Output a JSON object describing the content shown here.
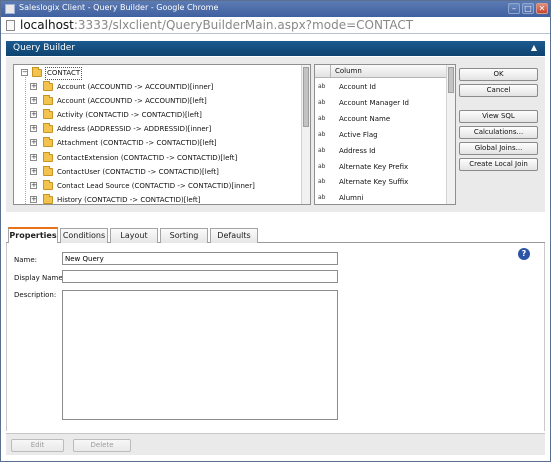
{
  "window": {
    "title": "Saleslogix Client - Query Builder - Google Chrome",
    "minimize_glyph": "–",
    "maximize_glyph": "□",
    "close_glyph": "✕"
  },
  "address_bar": {
    "host": "localhost",
    "rest": ":3333/slxclient/QueryBuilderMain.aspx?mode=CONTACT"
  },
  "header": {
    "title": "Query Builder",
    "pin_icon": "pin-icon"
  },
  "tree": {
    "root": {
      "label": "CONTACT",
      "expander": "−"
    },
    "items": [
      {
        "label": "Account (ACCOUNTID -> ACCOUNTID)[inner]",
        "expander": "+"
      },
      {
        "label": "Account (ACCOUNTID -> ACCOUNTID)[left]",
        "expander": "+"
      },
      {
        "label": "Activity (CONTACTID -> CONTACTID)[left]",
        "expander": "+"
      },
      {
        "label": "Address (ADDRESSID -> ADDRESSID)[inner]",
        "expander": "+"
      },
      {
        "label": "Attachment (CONTACTID -> CONTACTID)[left]",
        "expander": "+"
      },
      {
        "label": "ContactExtension (CONTACTID -> CONTACTID)[left]",
        "expander": "+"
      },
      {
        "label": "ContactUser (CONTACTID -> CONTACTID)[left]",
        "expander": "+"
      },
      {
        "label": "Contact Lead Source (CONTACTID -> CONTACTID)[inner]",
        "expander": "+"
      },
      {
        "label": "History (CONTACTID -> CONTACTID)[left]",
        "expander": "+"
      }
    ]
  },
  "columns": {
    "header": "Column",
    "rows": [
      {
        "type": "ab",
        "name": "Account Id"
      },
      {
        "type": "ab",
        "name": "Account Manager Id"
      },
      {
        "type": "ab",
        "name": "Account Name"
      },
      {
        "type": "ab",
        "name": "Active Flag"
      },
      {
        "type": "ab",
        "name": "Address Id"
      },
      {
        "type": "ab",
        "name": "Alternate Key Prefix"
      },
      {
        "type": "ab",
        "name": "Alternate Key Suffix"
      },
      {
        "type": "ab",
        "name": "Alumni"
      }
    ]
  },
  "buttons": {
    "ok": "OK",
    "cancel": "Cancel",
    "view_sql": "View SQL",
    "calculations": "Calculations...",
    "global_joins": "Global Joins...",
    "create_local_join": "Create Local Join"
  },
  "tabs": [
    "Properties",
    "Conditions",
    "Layout",
    "Sorting",
    "Defaults"
  ],
  "active_tab": "Properties",
  "properties": {
    "name_label": "Name:",
    "name_value": "New Query",
    "display_name_label": "Display Name:",
    "display_name_value": "",
    "description_label": "Description:",
    "description_value": "",
    "help_glyph": "?"
  },
  "footer": {
    "edit": "Edit",
    "delete": "Delete"
  },
  "colors": {
    "header_bg": "#0d436f",
    "active_tab_accent": "#e8721b",
    "folder": "#f2c34d",
    "help": "#2b54a6"
  }
}
